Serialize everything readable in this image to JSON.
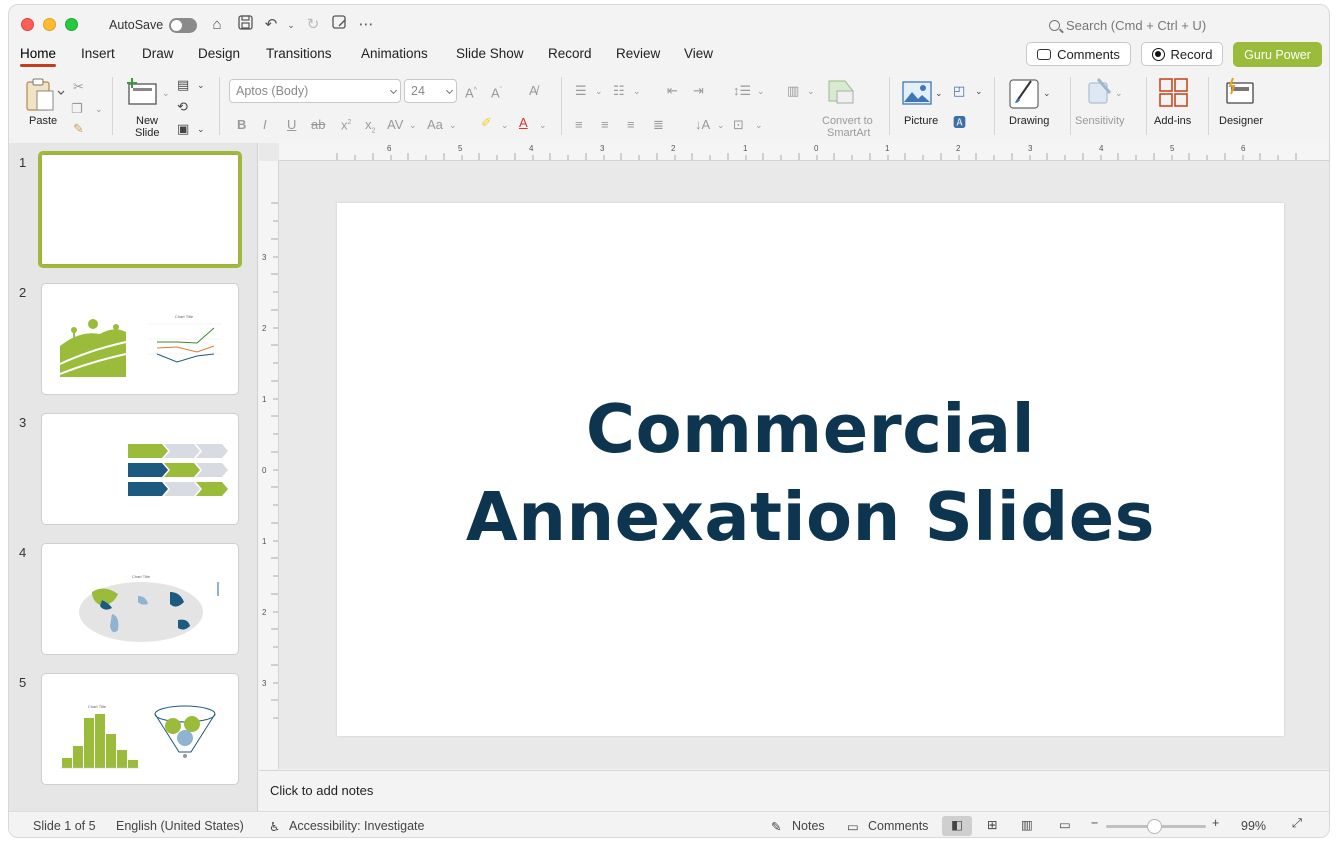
{
  "titlebar": {
    "autosave_label": "AutoSave",
    "search_placeholder": "Search (Cmd + Ctrl + U)"
  },
  "menu": {
    "tabs": [
      "Home",
      "Insert",
      "Draw",
      "Design",
      "Transitions",
      "Animations",
      "Slide Show",
      "Record",
      "Review",
      "View"
    ],
    "active_tab": "Home",
    "comments_label": "Comments",
    "record_label": "Record",
    "guru_label": "Guru Power"
  },
  "ribbon": {
    "paste": "Paste",
    "new_slide_1": "New",
    "new_slide_2": "Slide",
    "font_name": "Aptos (Body)",
    "font_size": "24",
    "convert_1": "Convert to",
    "convert_2": "SmartArt",
    "picture": "Picture",
    "drawing": "Drawing",
    "sensitivity": "Sensitivity",
    "addins": "Add-ins",
    "designer": "Designer"
  },
  "slides": {
    "numbers": [
      "1",
      "2",
      "3",
      "4",
      "5"
    ],
    "thumb2_chart_title": "Chart Title",
    "thumb4_chart_title": "Chart Title",
    "thumb5_chart_title": "Chart Title"
  },
  "slide": {
    "title_line1": "Commercial",
    "title_line2": "Annexation Slides"
  },
  "ruler": {
    "h_labels": [
      "6",
      "5",
      "4",
      "3",
      "2",
      "1",
      "0",
      "1",
      "2",
      "3",
      "4",
      "5",
      "6"
    ],
    "v_labels": [
      "3",
      "2",
      "1",
      "0",
      "1",
      "2",
      "3"
    ]
  },
  "notes": {
    "placeholder": "Click to add notes"
  },
  "status": {
    "slide_of": "Slide 1 of 5",
    "language": "English (United States)",
    "accessibility": "Accessibility: Investigate",
    "notes": "Notes",
    "comments": "Comments",
    "zoom": "99%"
  },
  "colors": {
    "accent_green": "#9bbb3a",
    "title_navy": "#0d3550",
    "active_tab_underline": "#c43e1c"
  }
}
